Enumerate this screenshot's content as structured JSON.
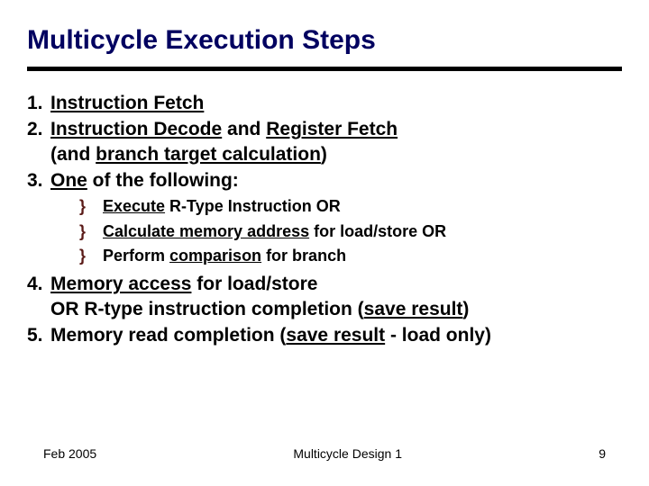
{
  "title": "Multicycle Execution Steps",
  "items": {
    "n1": "1.",
    "t1a": "Instruction Fetch",
    "n2": "2.",
    "t2a": "Instruction Decode",
    "t2b": " and ",
    "t2c": "Register Fetch",
    "t2d": "(and ",
    "t2e": "branch target calculation",
    "t2f": ")",
    "n3": "3.",
    "t3a": "One",
    "t3b": " of the following:",
    "bullet": "}",
    "s1a": "Execute",
    "s1b": " R-Type Instruction OR",
    "s2a": "Calculate memory address",
    "s2b": " for load/store OR",
    "s3a": "Perform ",
    "s3b": "comparison",
    "s3c": " for branch",
    "n4": "4.",
    "t4a": "Memory access",
    "t4b": " for load/store",
    "t4c": "OR R-type instruction completion (",
    "t4d": "save result",
    "t4e": ")",
    "n5": "5.",
    "t5a": "Memory read completion (",
    "t5b": "save result",
    "t5c": " - load only)"
  },
  "footer": {
    "left": "Feb 2005",
    "center": "Multicycle Design 1",
    "right": "9"
  }
}
